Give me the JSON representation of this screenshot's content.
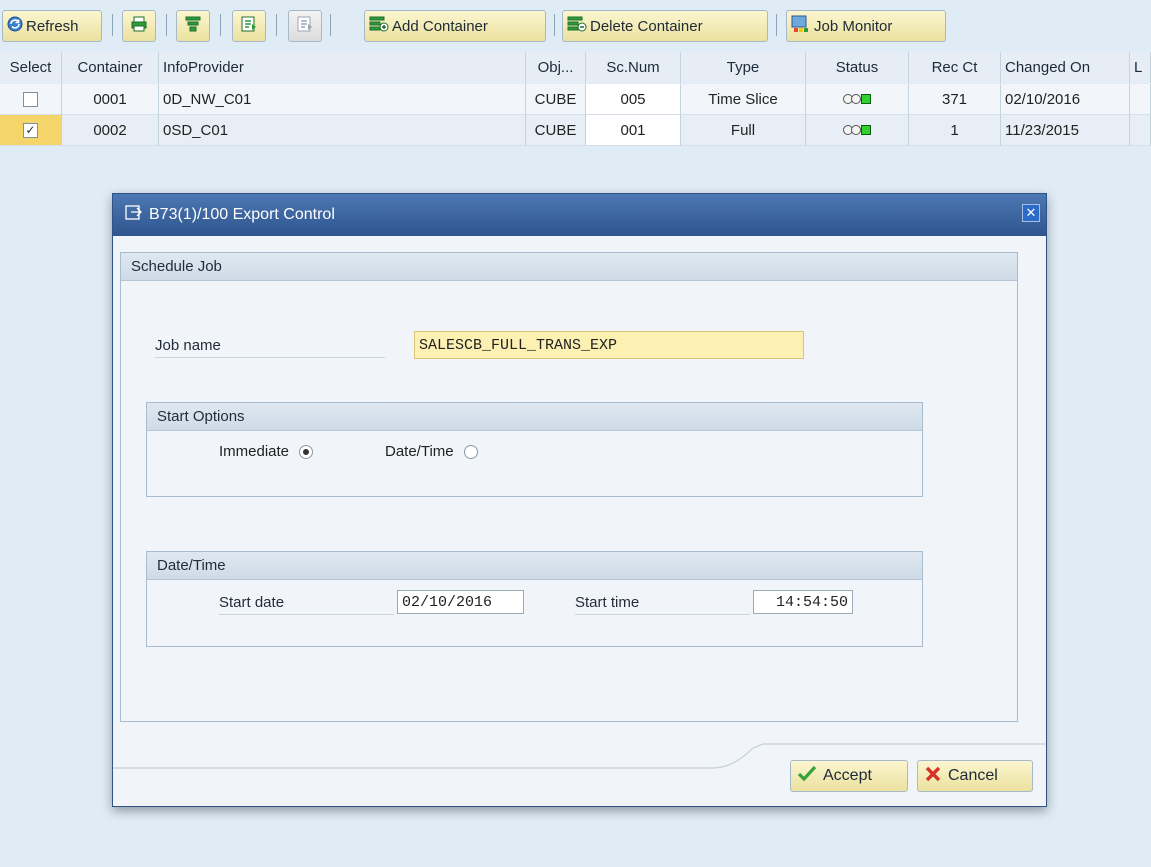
{
  "toolbar": {
    "refresh": "Refresh",
    "add_container": "Add Container",
    "delete_container": "Delete Container",
    "job_monitor": "Job Monitor"
  },
  "table": {
    "headers": [
      "Select",
      "Container",
      "InfoProvider",
      "Obj...",
      "Sc.Num",
      "Type",
      "Status",
      "Rec Ct",
      "Changed On",
      "L"
    ],
    "rows": [
      {
        "selected": false,
        "container": "0001",
        "infoprovider": "0D_NW_C01",
        "obj": "CUBE",
        "scnum": "005",
        "type": "Time Slice",
        "status": "green",
        "recct": "371",
        "changed": "02/10/2016"
      },
      {
        "selected": true,
        "container": "0002",
        "infoprovider": "0SD_C01",
        "obj": "CUBE",
        "scnum": "001",
        "type": "Full",
        "status": "green",
        "recct": "1",
        "changed": "11/23/2015"
      }
    ]
  },
  "dialog": {
    "title": "B73(1)/100 Export Control",
    "group_title": "Schedule Job",
    "job_name_label": "Job name",
    "job_name_value": "SALESCB_FULL_TRANS_EXP",
    "start_options": {
      "title": "Start Options",
      "immediate_label": "Immediate",
      "immediate_selected": true,
      "datetime_label": "Date/Time",
      "datetime_selected": false
    },
    "datetime_group": {
      "title": "Date/Time",
      "start_date_label": "Start date",
      "start_date_value": "02/10/2016",
      "start_time_label": "Start time",
      "start_time_value": "14:54:50"
    },
    "accept_label": "Accept",
    "cancel_label": "Cancel"
  },
  "icons": {
    "refresh": "refresh-icon",
    "print": "print-icon",
    "filter": "filter-icon",
    "export": "export-icon",
    "add": "add-container-icon",
    "delete": "delete-container-icon",
    "monitor": "job-monitor-icon",
    "dialog": "dialog-window-icon",
    "close": "close-icon",
    "accept": "checkmark-icon",
    "cancel": "cancel-x-icon"
  },
  "colors": {
    "accent": "#2e558e",
    "highlight": "#f5d56a",
    "status_green": "#2fd12f"
  }
}
